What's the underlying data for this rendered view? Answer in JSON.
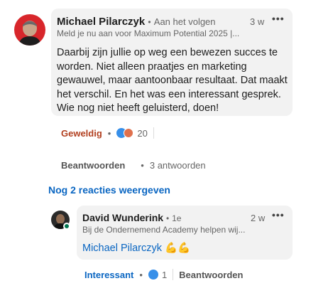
{
  "comment1": {
    "author": "Michael Pilarczyk",
    "follow_status": "Aan het volgen",
    "headline": "Meld je nu aan voor Maximum Potential 2025 |...",
    "time": "3 w",
    "more_icon": "more-options-icon",
    "text": "Daarbij zijn jullie op weg een bewezen succes te worden. Niet alleen praatjes en marketing gewauwel, maar aantoonbaar resultaat. Dat maakt het verschil. En het was een interessant gesprek. Wie nog niet heeft geluisterd, doen!",
    "reaction_label": "Geweldig",
    "reaction_count": "20",
    "reply_label": "Beantwoorden",
    "replies_count": "3 antwoorden",
    "colors": {
      "reaction": "#b24020",
      "like": "#378fe9",
      "love": "#df704d"
    }
  },
  "show_more": "Nog 2 reacties weergeven",
  "comment2": {
    "author": "David Wunderink",
    "degree": "1e",
    "headline": "Bij de Ondernemend Academy helpen wij...",
    "time": "2 w",
    "mention": "Michael Pilarczyk",
    "emoji": "💪💪",
    "reaction_label": "Interessant",
    "reaction_count": "1",
    "reply_label": "Beantwoorden",
    "colors": {
      "reaction": "#0a66c2",
      "online": "#01754f"
    }
  }
}
